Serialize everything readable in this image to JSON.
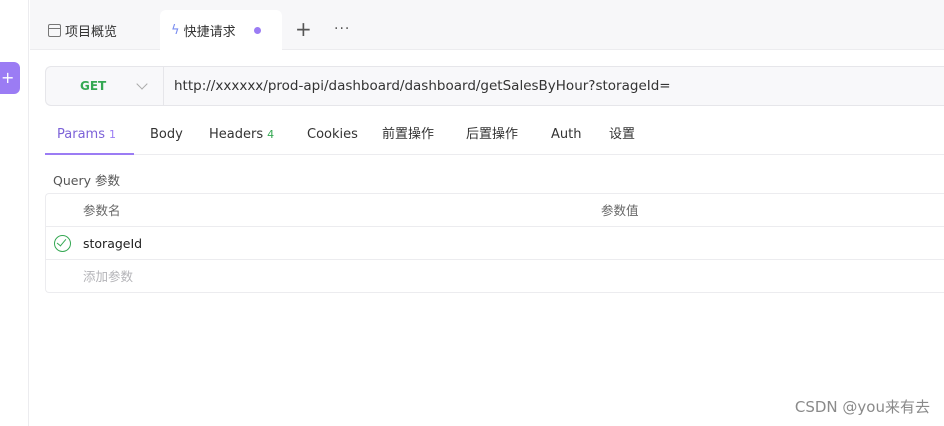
{
  "sidebar": {
    "add_icon_glyph": "+"
  },
  "tabs": {
    "overview_label": "项目概览",
    "quick_label": "快捷请求",
    "quick_icon": "bolt-icon",
    "unsaved_dot_color": "#9b7cf4",
    "plus_glyph": "+",
    "more_glyph": "···"
  },
  "request": {
    "method": "GET",
    "url": "http://xxxxxx/prod-api/dashboard/dashboard/getSalesByHour?storageId="
  },
  "subtabs": [
    {
      "label": "Params",
      "count": "1",
      "active": true
    },
    {
      "label": "Body"
    },
    {
      "label": "Headers",
      "count": "4"
    },
    {
      "label": "Cookies"
    },
    {
      "label": "前置操作"
    },
    {
      "label": "后置操作"
    },
    {
      "label": "Auth"
    },
    {
      "label": "设置"
    }
  ],
  "params": {
    "section_label": "Query 参数",
    "columns": [
      "参数名",
      "参数值"
    ],
    "rows": [
      {
        "enabled": true,
        "name": "storageId",
        "value": ""
      }
    ],
    "add_placeholder": "添加参数"
  },
  "watermark": "CSDN @you来有去",
  "colors": {
    "accent": "#9b7cf4",
    "get_method": "#35a853"
  }
}
